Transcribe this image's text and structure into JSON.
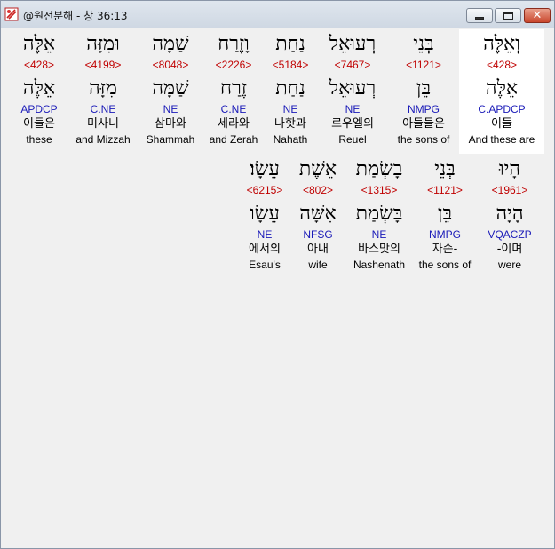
{
  "window": {
    "title": "@원전분해 - 창 36:13",
    "close_glyph": "✕"
  },
  "row1": [
    {
      "hebrew": "וְאֵלֶּה",
      "strong": "<428>",
      "lemma": "אֵלֶּה",
      "parse": "C.APDCP",
      "korean": "이들",
      "english": "And these are"
    },
    {
      "hebrew": "בְּנֵי",
      "strong": "<1121>",
      "lemma": "בֵּן",
      "parse": "NMPG",
      "korean": "아들들은",
      "english": "the sons of"
    },
    {
      "hebrew": "רְעוּאֵל",
      "strong": "<7467>",
      "lemma": "רְעוּאֵל",
      "parse": "NE",
      "korean": "르우엘의",
      "english": "Reuel"
    },
    {
      "hebrew": "נַחַת",
      "strong": "<5184>",
      "lemma": "נַחַת",
      "parse": "NE",
      "korean": "나핫과",
      "english": "Nahath"
    },
    {
      "hebrew": "וָזֶרַח",
      "strong": "<2226>",
      "lemma": "זֶרַח",
      "parse": "C.NE",
      "korean": "세라와",
      "english": "and Zerah"
    },
    {
      "hebrew": "שַׁמָּה",
      "strong": "<8048>",
      "lemma": "שַׁמָּה",
      "parse": "NE",
      "korean": "삼마와",
      "english": "Shammah"
    },
    {
      "hebrew": "וּמִזָּה",
      "strong": "<4199>",
      "lemma": "מִזָּה",
      "parse": "C.NE",
      "korean": "미사니",
      "english": "and Mizzah"
    },
    {
      "hebrew": "אֵלֶּה",
      "strong": "<428>",
      "lemma": "אֵלֶּה",
      "parse": "APDCP",
      "korean": "이들은",
      "english": "these"
    }
  ],
  "row2": [
    {
      "hebrew": "הָיוּ",
      "strong": "<1961>",
      "lemma": "הָיָה",
      "parse": "VQACZP",
      "korean": "-이며",
      "english": "were"
    },
    {
      "hebrew": "בְּנֵי",
      "strong": "<1121>",
      "lemma": "בֵּן",
      "parse": "NMPG",
      "korean": "자손-",
      "english": "the sons of"
    },
    {
      "hebrew": "בָשְׂמַת",
      "strong": "<1315>",
      "lemma": "בָּשְׂמַת",
      "parse": "NE",
      "korean": "바스맛의",
      "english": "Nashenath"
    },
    {
      "hebrew": "אֵשֶׁת",
      "strong": "<802>",
      "lemma": "אִשָּׁה",
      "parse": "NFSG",
      "korean": "아내",
      "english": "wife"
    },
    {
      "hebrew": "עֵשָׂו׃",
      "strong": "<6215>",
      "lemma": "עֵשָׂו",
      "parse": "NE",
      "korean": "에서의",
      "english": "Esau's"
    }
  ]
}
